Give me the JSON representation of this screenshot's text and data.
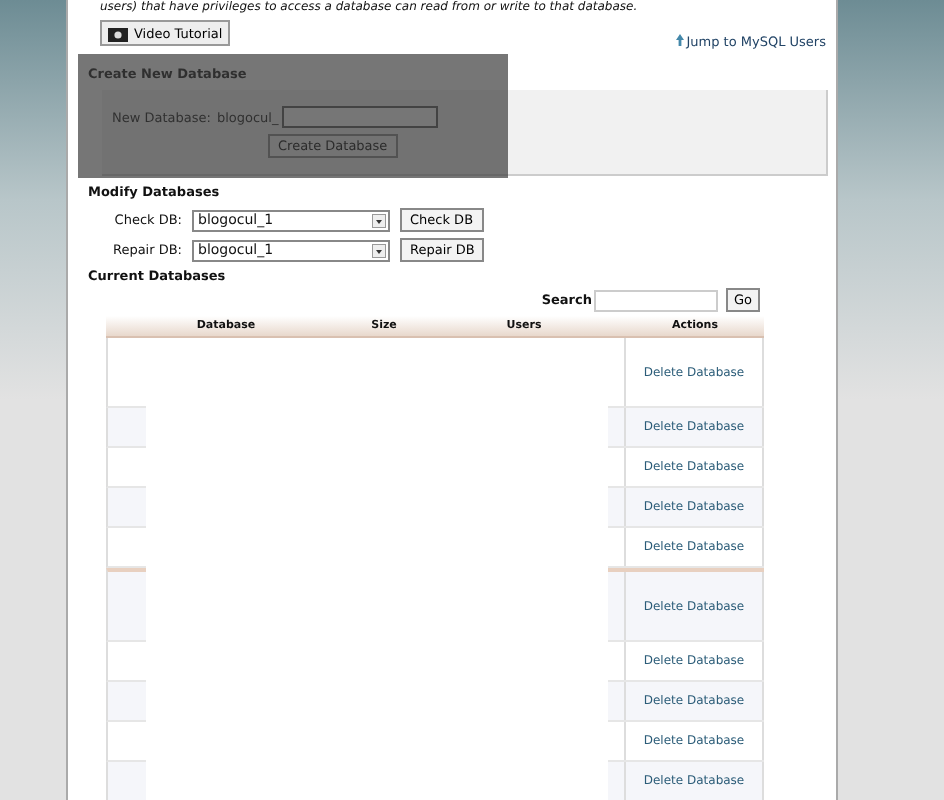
{
  "intro_text": "users) that have privileges to access a database can read from or write to that database.",
  "video_button": "Video Tutorial",
  "jump_link": "Jump to MySQL Users",
  "create": {
    "title": "Create New Database",
    "label": "New Database:",
    "prefix": "blogocul_",
    "button": "Create Database"
  },
  "modify": {
    "title": "Modify Databases",
    "rows": [
      {
        "label": "Check DB:",
        "value": "blogocul_1",
        "button": "Check DB"
      },
      {
        "label": "Repair DB:",
        "value": "blogocul_1",
        "button": "Repair DB"
      }
    ]
  },
  "current": {
    "title": "Current Databases",
    "search_label": "Search",
    "go_button": "Go",
    "columns": [
      "Database",
      "Size",
      "Users",
      "Actions"
    ],
    "rows": [
      {
        "kind": "tall",
        "action": "Delete Database"
      },
      {
        "kind": "normal",
        "action": "Delete Database"
      },
      {
        "kind": "normal",
        "action": "Delete Database"
      },
      {
        "kind": "normal",
        "action": "Delete Database"
      },
      {
        "kind": "normal",
        "action": "Delete Database"
      },
      {
        "kind": "tall",
        "action": "Delete Database"
      },
      {
        "kind": "normal",
        "action": "Delete Database"
      },
      {
        "kind": "normal",
        "action": "Delete Database"
      },
      {
        "kind": "normal",
        "action": "Delete Database"
      },
      {
        "kind": "normal",
        "action": "Delete Database"
      }
    ]
  }
}
